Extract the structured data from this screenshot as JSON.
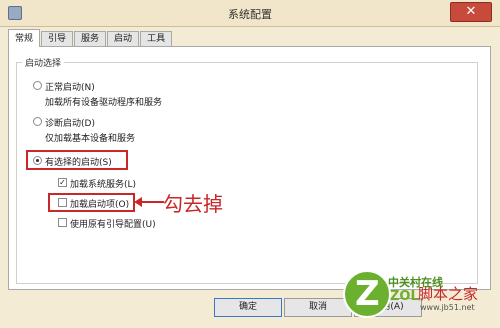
{
  "window": {
    "title": "系统配置",
    "close_glyph": "✕"
  },
  "tabs": [
    {
      "label": "常规",
      "active": true
    },
    {
      "label": "引导",
      "active": false
    },
    {
      "label": "服务",
      "active": false
    },
    {
      "label": "启动",
      "active": false
    },
    {
      "label": "工具",
      "active": false
    }
  ],
  "startup_group": {
    "title": "启动选择",
    "normal": {
      "label": "正常启动(N)",
      "desc": "加载所有设备驱动程序和服务",
      "selected": false
    },
    "diagnostic": {
      "label": "诊断启动(D)",
      "desc": "仅加载基本设备和服务",
      "selected": false
    },
    "selective": {
      "label": "有选择的启动(S)",
      "selected": true
    },
    "options": [
      {
        "label": "加载系统服务(L)",
        "checked": true
      },
      {
        "label": "加载启动项(O)",
        "checked": false
      },
      {
        "label": "使用原有引导配置(U)",
        "checked": false
      }
    ]
  },
  "annotation": "勾去掉",
  "buttons": {
    "ok": "确定",
    "cancel": "取消",
    "apply": "应用(A)"
  },
  "watermark": {
    "logo_letter": "Z",
    "brand": "中关村在线",
    "brand_latin": "ZOL",
    "site_cn": "脚本之家",
    "site_url": "www.jb51.net"
  },
  "colors": {
    "highlight": "#c82828",
    "titlebar": "#f1e6c9",
    "close_button": "#c84a3b"
  }
}
